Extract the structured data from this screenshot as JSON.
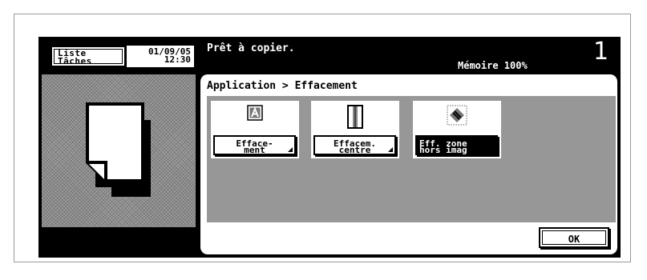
{
  "header": {
    "job_list_line1": "Liste",
    "job_list_line2": "Tâches",
    "date": "01/09/05",
    "time": "12:30",
    "status_message": "Prêt à copier.",
    "memory": "Mémoire 100%",
    "copy_count": "1"
  },
  "breadcrumb": "Application > Effacement",
  "options": [
    {
      "line1": "Efface-",
      "line2": "ment",
      "icon": "letter-a-frame-icon",
      "selected": false
    },
    {
      "line1": "Effacem.",
      "line2": "centre",
      "icon": "center-erase-icon",
      "selected": false
    },
    {
      "line1": "Eff. zone",
      "line2": "hors imag",
      "icon": "non-image-area-icon",
      "selected": true
    }
  ],
  "ok_label": "OK"
}
